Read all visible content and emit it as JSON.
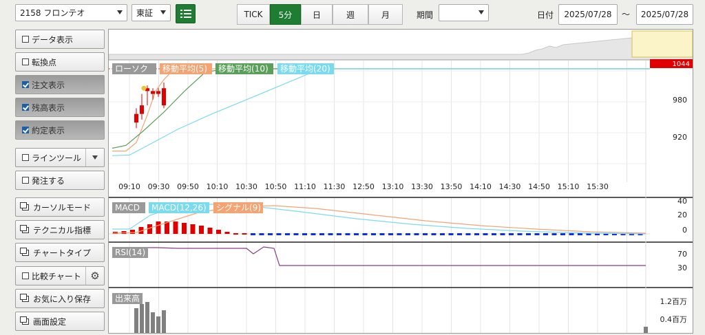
{
  "toolbar": {
    "stock": "2158 フロンテオ",
    "market": "東証",
    "list_icon": "list-icon",
    "periods": [
      "TICK",
      "5分",
      "日",
      "週",
      "月"
    ],
    "active_period": "5分",
    "range_label": "期間",
    "range_value": "",
    "date_label": "日付",
    "date_from": "2025/07/28",
    "date_sep": "〜",
    "date_to": "2025/07/28",
    "accent": "#1e7d32"
  },
  "sidebar": [
    {
      "label": "データ表示",
      "kind": "check",
      "checked": false
    },
    {
      "label": "転換点",
      "kind": "check",
      "checked": false
    },
    {
      "label": "注文表示",
      "kind": "check",
      "checked": true
    },
    {
      "label": "残高表示",
      "kind": "check",
      "checked": true
    },
    {
      "label": "約定表示",
      "kind": "check",
      "checked": true
    },
    {
      "label": "ラインツール",
      "kind": "check-dropdown",
      "checked": false
    },
    {
      "label": "発注する",
      "kind": "check",
      "checked": false
    },
    {
      "label": "カーソルモード",
      "kind": "window"
    },
    {
      "label": "テクニカル指標",
      "kind": "window"
    },
    {
      "label": "チャートタイプ",
      "kind": "window"
    },
    {
      "label": "比較チャート",
      "kind": "check-gear",
      "checked": false
    },
    {
      "label": "お気に入り保存",
      "kind": "window"
    },
    {
      "label": "画面設定",
      "kind": "window"
    }
  ],
  "chart": {
    "price_legend": [
      "ローソク",
      "移動平均(5)",
      "移動平均(10)",
      "移動平均(20)"
    ],
    "legend_colors": [
      "#999999",
      "#f4a373",
      "#5aa05a",
      "#7adbee"
    ],
    "price_ticks": [
      "980",
      "920"
    ],
    "last_price": "1044",
    "time_ticks": [
      "09:10",
      "09:30",
      "09:50",
      "10:10",
      "10:30",
      "10:50",
      "11:10",
      "11:30",
      "12:50",
      "13:10",
      "13:30",
      "13:50",
      "14:10",
      "14:30",
      "14:50",
      "15:10",
      "15:30"
    ],
    "macd_legend": [
      "MACD",
      "MACD(12,26)",
      "シグナル(9)"
    ],
    "macd_ticks": [
      "40",
      "20",
      "0"
    ],
    "rsi_legend": "RSI(14)",
    "rsi_ticks": [
      "70",
      "30"
    ],
    "vol_legend": "出来高",
    "vol_ticks": [
      "1.2百万",
      "0.4百万"
    ]
  },
  "chart_data": [
    {
      "type": "candlestick",
      "title": "",
      "x": [
        "09:00",
        "09:05",
        "09:10",
        "09:15",
        "09:20",
        "09:25"
      ],
      "open": [
        950,
        965,
        1005,
        1000,
        1000,
        980
      ],
      "close": [
        965,
        980,
        1010,
        1005,
        1005,
        1010
      ],
      "high": [
        975,
        1000,
        1015,
        1010,
        1010,
        1020
      ],
      "low": [
        940,
        955,
        980,
        990,
        995,
        975
      ],
      "series": [
        {
          "name": "移動平均(5)",
          "color": "#f4a373"
        },
        {
          "name": "移動平均(10)",
          "color": "#5aa05a"
        },
        {
          "name": "移動平均(20)",
          "color": "#7adbee"
        }
      ],
      "last_price": 1044
    },
    {
      "type": "bar",
      "title": "MACD",
      "x_range": [
        "09:00",
        "15:30"
      ],
      "series": [
        {
          "name": "MACD(12,26)",
          "color": "#7adbee",
          "peak": 38
        },
        {
          "name": "シグナル(9)",
          "color": "#f4a373",
          "peak": 32
        }
      ],
      "histogram_positive_color": "#e00000",
      "histogram_negative_color": "#1030e0",
      "ylim": [
        0,
        40
      ]
    },
    {
      "type": "line",
      "title": "RSI(14)",
      "series": [
        {
          "name": "RSI(14)",
          "color": "#8a3a8a",
          "values_start": 78,
          "values_end": 36
        }
      ],
      "ylim": [
        30,
        70
      ]
    },
    {
      "type": "bar",
      "title": "出来高",
      "x": [
        "09:00",
        "09:05",
        "09:10",
        "09:15",
        "09:20",
        "09:25"
      ],
      "values": [
        1.2,
        1.4,
        1.5,
        1.0,
        0.8,
        1.1
      ],
      "last_value": 0.3,
      "unit": "百万"
    }
  ]
}
